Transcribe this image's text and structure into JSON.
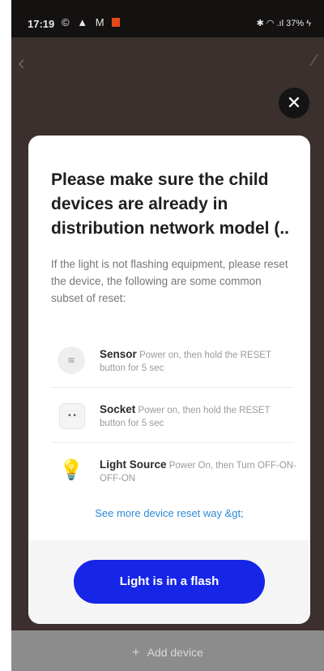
{
  "status_bar": {
    "time": "17:19",
    "left_icons": [
      "whatsapp-icon",
      "notification-icon",
      "m-icon",
      "red-app-icon"
    ],
    "right_text": "✱ ◠ .ıl 37% ϟ"
  },
  "modal": {
    "title": "Please make sure the child devices are already in distribution network model (..",
    "description": "If the light is not flashing equipment, please reset the device, the following are some common subset of reset:",
    "devices": [
      {
        "name": "Sensor",
        "instruction": "Power on, then hold the RESET button for 5 sec",
        "icon": "sensor-icon"
      },
      {
        "name": "Socket",
        "instruction": "Power on, then hold the RESET button for 5 sec",
        "icon": "socket-icon"
      },
      {
        "name": "Light Source",
        "instruction": "Power On, then Turn OFF-ON-OFF-ON",
        "icon": "bulb-icon"
      }
    ],
    "more_link": "See more device reset way &gt;",
    "primary_button": "Light is in a flash",
    "close_icon": "close-icon"
  },
  "bottom_bar": {
    "add_device_label": "Add device"
  },
  "colors": {
    "primary": "#1725e6",
    "link": "#2e89d6",
    "backdrop": "#3b302d"
  }
}
